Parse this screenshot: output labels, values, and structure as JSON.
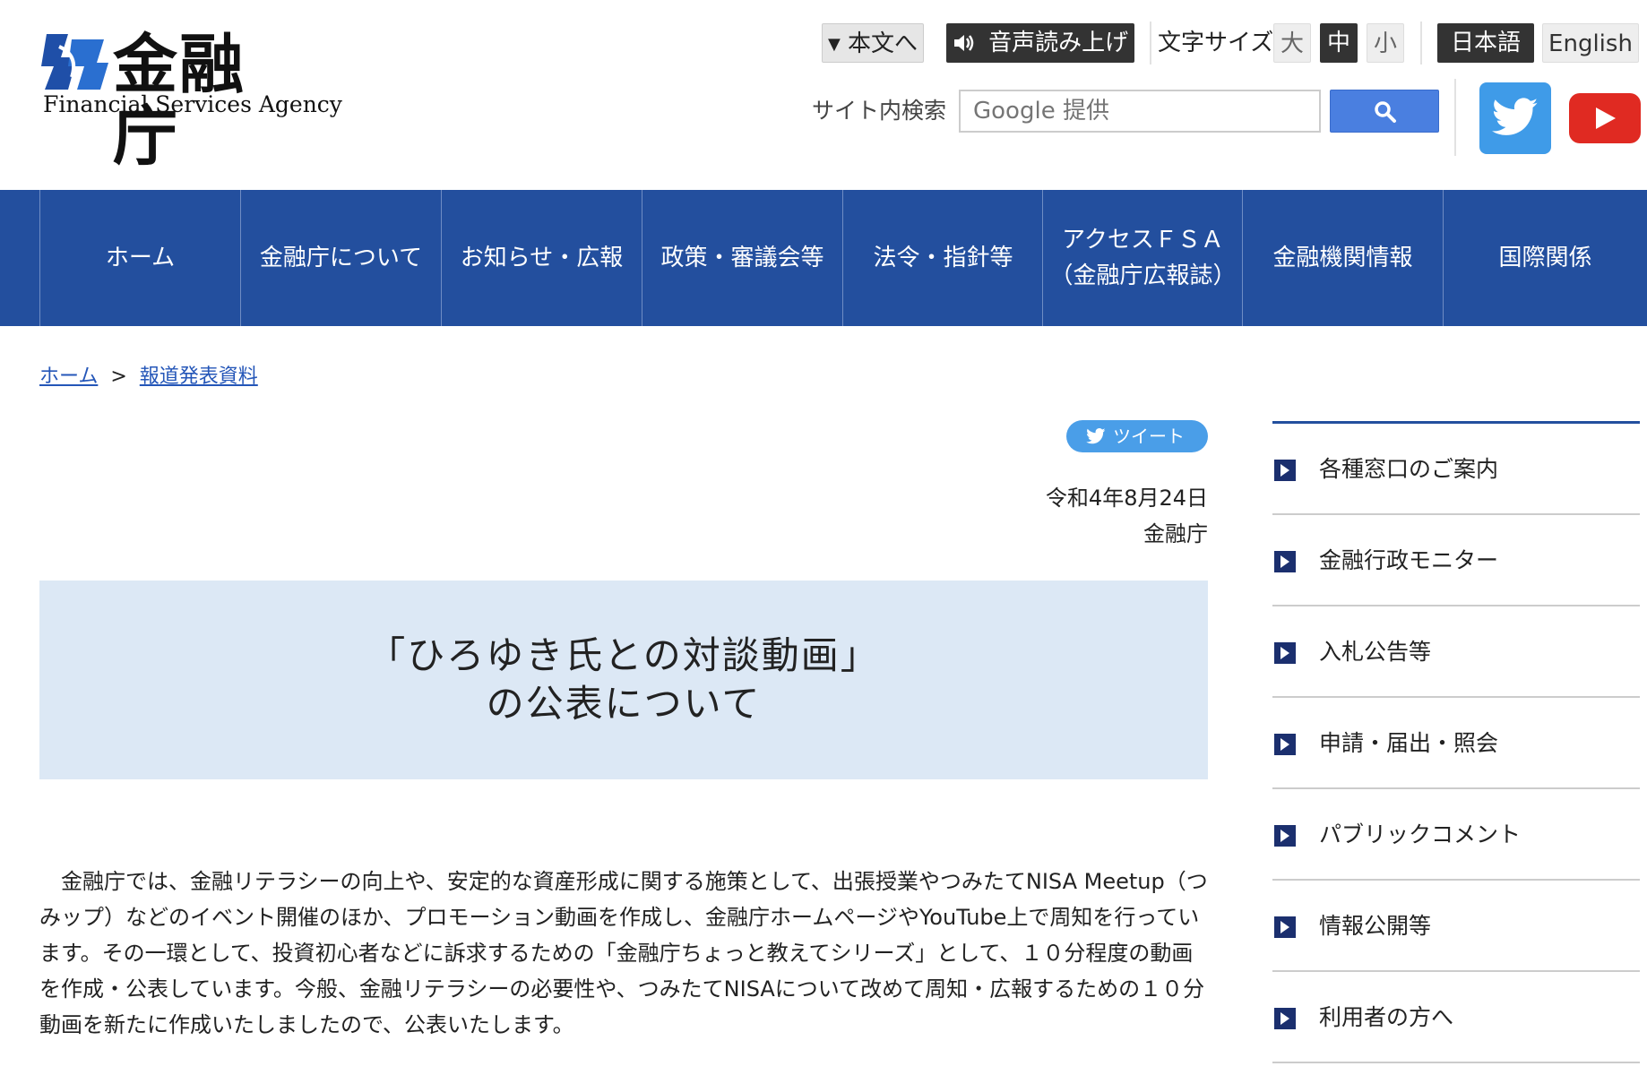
{
  "header": {
    "logo_title": "金融庁",
    "logo_subtitle": "Financial Services Agency",
    "skip_to_content": "本文へ",
    "voice_reading": "音声読み上げ",
    "font_size_label": "文字サイズ",
    "font_size_large": "大",
    "font_size_medium": "中",
    "font_size_small": "小",
    "lang_japanese": "日本語",
    "lang_english": "English",
    "search_label": "サイト内検索",
    "search_placeholder": "Google 提供"
  },
  "nav": {
    "items": [
      {
        "label": "ホーム"
      },
      {
        "label": "金融庁について"
      },
      {
        "label": "お知らせ・広報"
      },
      {
        "label": "政策・審議会等"
      },
      {
        "label": "法令・指針等"
      },
      {
        "label": "アクセスＦＳＡ\n（金融庁広報誌）"
      },
      {
        "label": "金融機関情報"
      },
      {
        "label": "国際関係"
      }
    ]
  },
  "breadcrumb": {
    "home": "ホーム",
    "separator": ">",
    "current": "報道発表資料"
  },
  "article": {
    "tweet_label": "ツイート",
    "date": "令和4年8月24日",
    "organization": "金融庁",
    "title_line1": "「ひろゆき氏との対談動画」",
    "title_line2": "の公表について",
    "body": "　金融庁では、金融リテラシーの向上や、安定的な資産形成に関する施策として、出張授業やつみたてNISA Meetup（つみップ）などのイベント開催のほか、プロモーション動画を作成し、金融庁ホームページやYouTube上で周知を行っています。その一環として、投資初心者などに訴求するための「金融庁ちょっと教えてシリーズ」として、１０分程度の動画を作成・公表しています。今般、金融リテラシーの必要性や、つみたてNISAについて改めて周知・広報するための１０分動画を新たに作成いたしましたので、公表いたします。"
  },
  "sidebar": {
    "items": [
      {
        "label": "各種窓口のご案内"
      },
      {
        "label": "金融行政モニター"
      },
      {
        "label": "入札公告等"
      },
      {
        "label": "申請・届出・照会"
      },
      {
        "label": "パブリックコメント"
      },
      {
        "label": "情報公開等"
      },
      {
        "label": "利用者の方へ"
      }
    ]
  },
  "colors": {
    "nav_background": "#234f9e",
    "title_box_background": "#dce8f5",
    "link": "#2456b8",
    "twitter": "#3f9be8",
    "youtube": "#e02a22",
    "search_button": "#4a7fe0"
  },
  "icons": {
    "logo_mark": "fsa-logo-icon",
    "triangle": "triangle-down-icon",
    "speaker": "speaker-icon",
    "search": "search-icon",
    "twitter": "twitter-icon",
    "youtube": "youtube-icon",
    "sidebar_arrow": "arrow-right-icon"
  }
}
